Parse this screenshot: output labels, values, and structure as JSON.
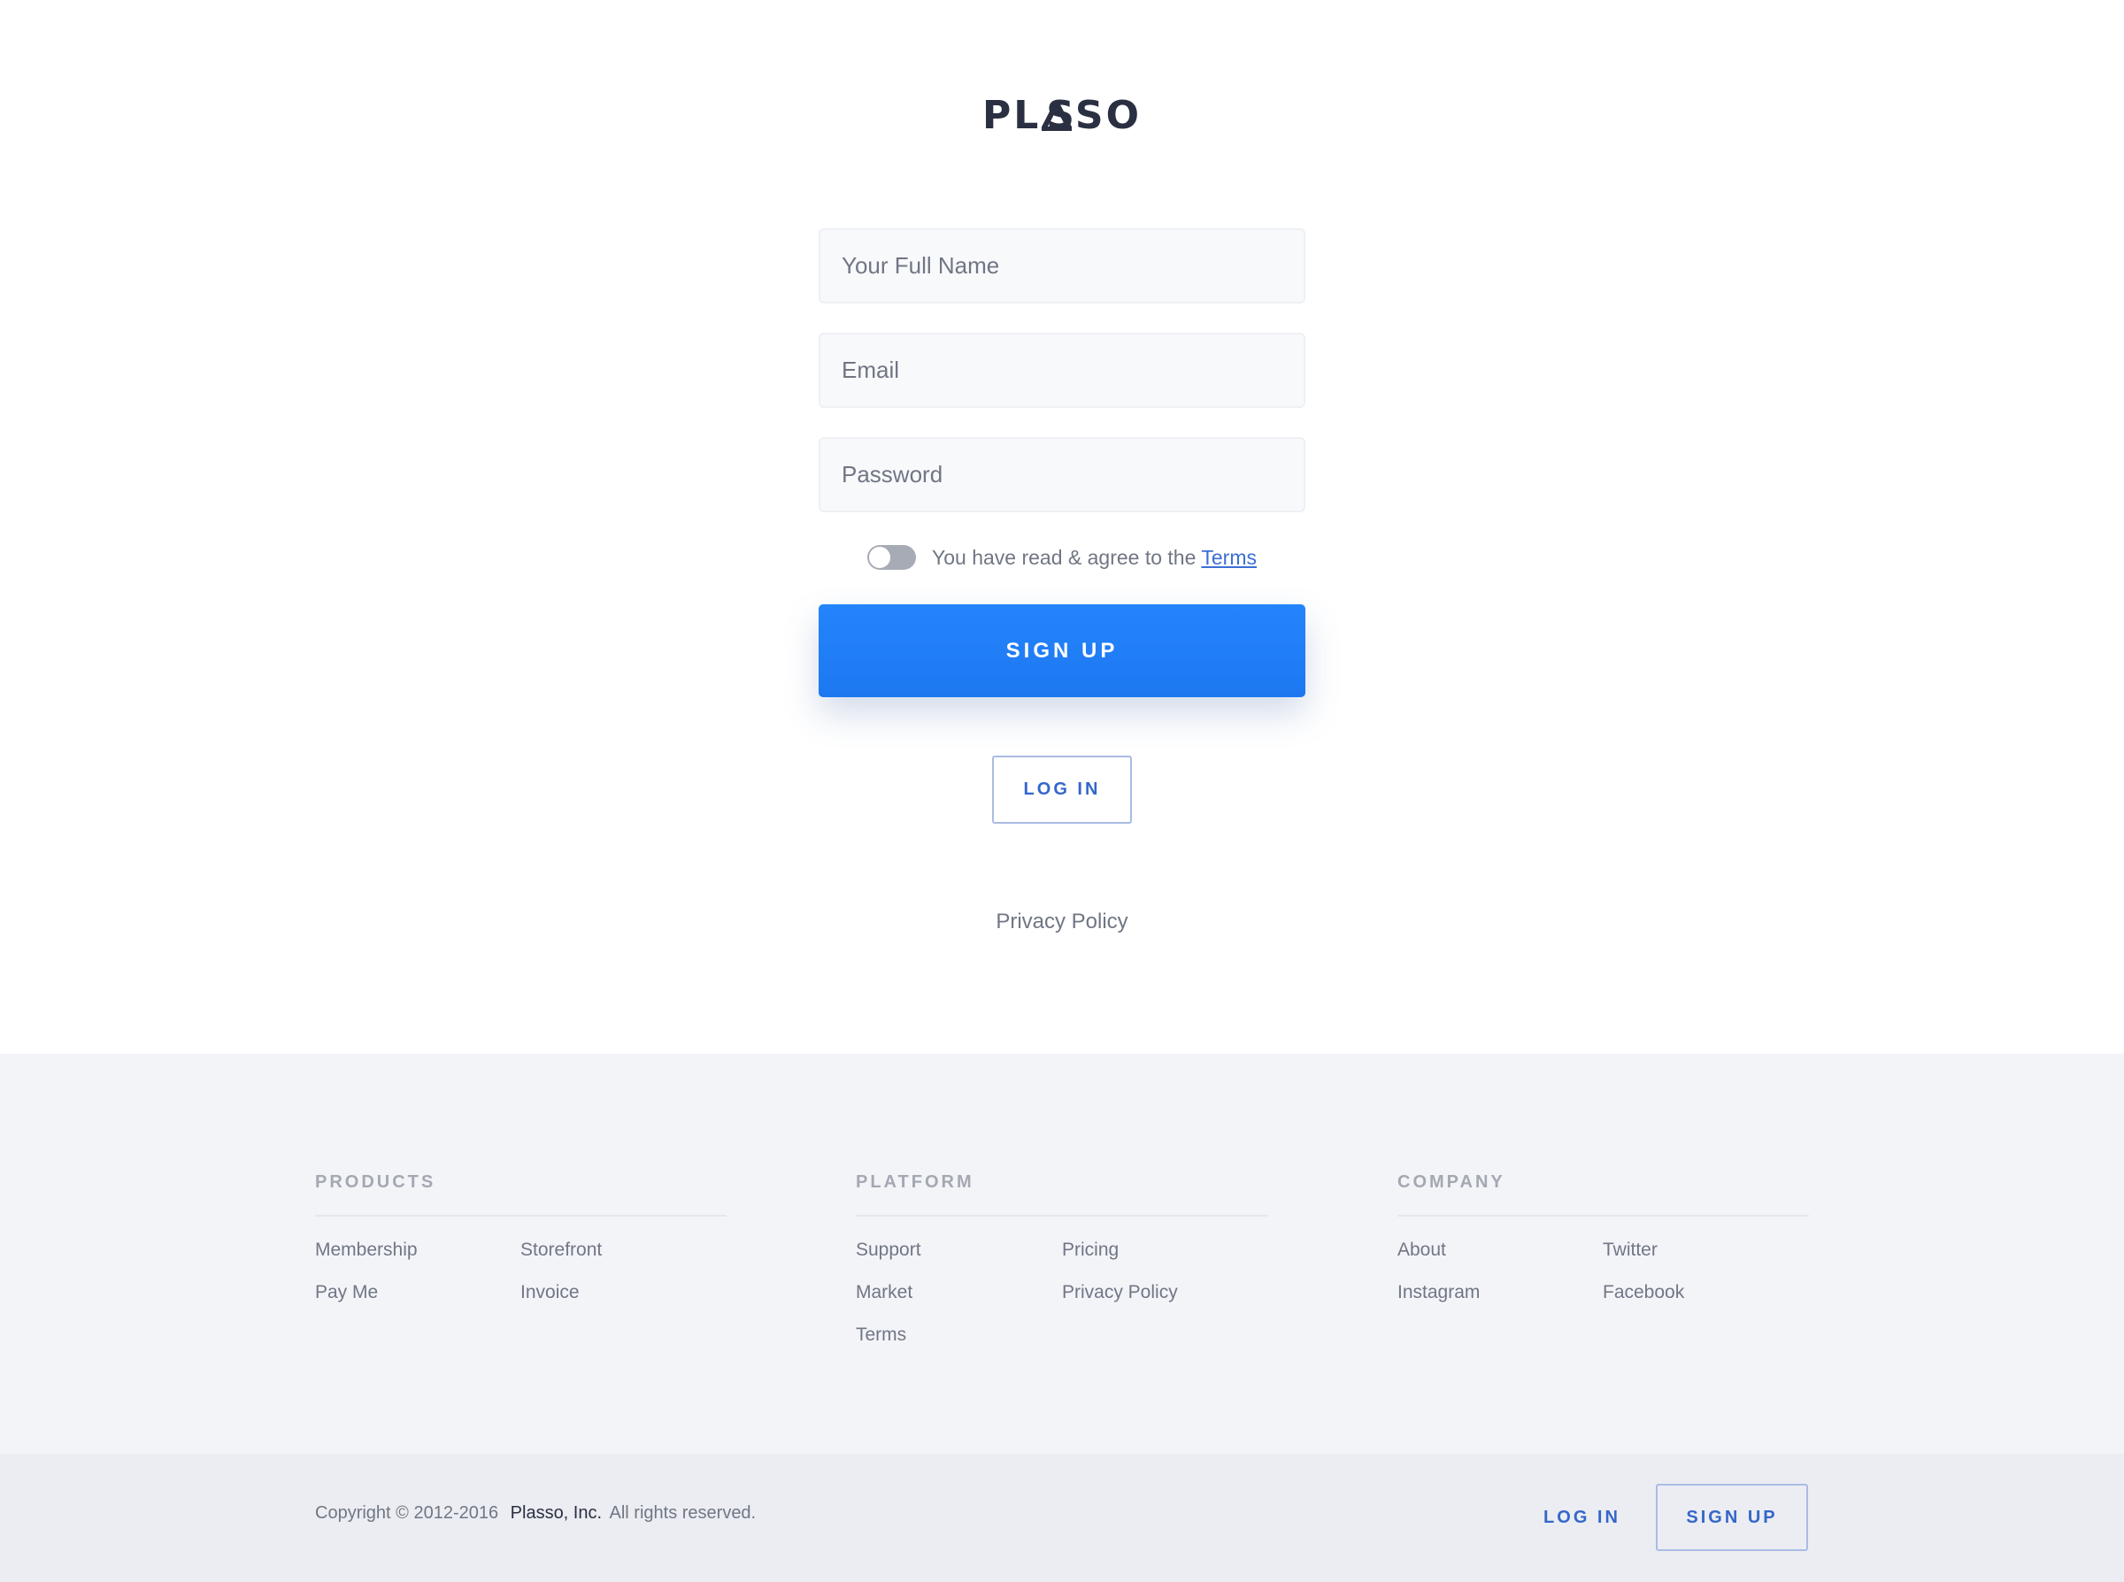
{
  "brand": {
    "logo_text_left": "PL",
    "logo_text_right": "SSO",
    "logo_icon": "triangle-a-icon",
    "color_text": "#2b2f42",
    "color_accent": "#1f80f8"
  },
  "form": {
    "name_placeholder": "Your Full Name",
    "email_placeholder": "Email",
    "password_placeholder": "Password",
    "terms_prefix": "You have read & agree to the",
    "terms_link": "Terms",
    "terms_agreed": false,
    "signup_label": "SIGN UP",
    "login_label": "LOG IN",
    "privacy_label": "Privacy Policy"
  },
  "footer": {
    "columns": [
      {
        "heading": "PRODUCTS",
        "links": [
          "Membership",
          "Storefront",
          "Pay Me",
          "Invoice"
        ]
      },
      {
        "heading": "PLATFORM",
        "links": [
          "Support",
          "Pricing",
          "Market",
          "Privacy Policy",
          "Terms"
        ]
      },
      {
        "heading": "COMPANY",
        "links": [
          "About",
          "Twitter",
          "Instagram",
          "Facebook"
        ]
      }
    ],
    "copyright_prefix": "Copyright © 2012-2016",
    "copyright_company": "Plasso, Inc.",
    "copyright_suffix": "All rights reserved.",
    "login_label": "LOG IN",
    "signup_label": "SIGN UP"
  }
}
